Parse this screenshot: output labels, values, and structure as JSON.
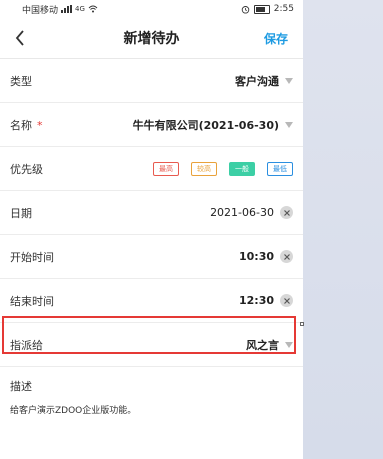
{
  "status_bar": {
    "carrier": "中国移动",
    "signal": "4G",
    "alarm_icon": "alarm-icon",
    "time": "2:55"
  },
  "header": {
    "title": "新增待办",
    "save": "保存",
    "back_icon": "chevron-left-icon"
  },
  "fields": {
    "type": {
      "label": "类型",
      "value": "客户沟通"
    },
    "name": {
      "label": "名称",
      "required": "*",
      "value": "牛牛有限公司(2021-06-30)"
    },
    "priority": {
      "label": "优先级",
      "options": [
        "最高",
        "较高",
        "一般",
        "最低"
      ],
      "selected": "一般"
    },
    "date": {
      "label": "日期",
      "value": "2021-06-30"
    },
    "start": {
      "label": "开始时间",
      "value": "10:30"
    },
    "end": {
      "label": "结束时间",
      "value": "12:30"
    },
    "assignee": {
      "label": "指派给",
      "value": "风之言"
    }
  },
  "description": {
    "label": "描述",
    "text": "给客户演示ZDOO企业版功能。"
  },
  "colors": {
    "accent": "#1e9be2",
    "highlight": "#e53935",
    "priority_high": "#e85a4f",
    "priority_mid": "#e9a23b",
    "priority_normal": "#3ccfa5",
    "priority_low": "#2b8fe0"
  }
}
